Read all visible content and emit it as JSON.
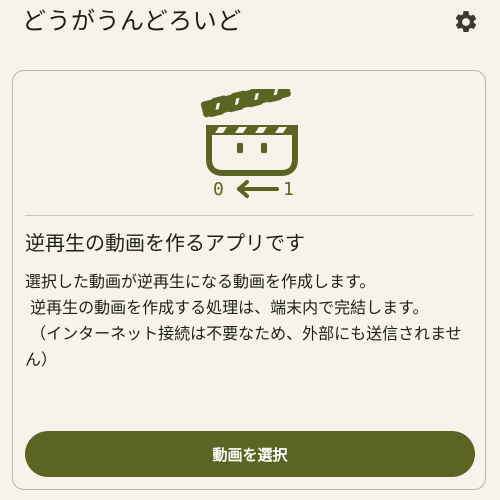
{
  "app": {
    "title": "どうがうんどろいど"
  },
  "header": {
    "settings_icon": "gear-icon"
  },
  "card": {
    "illustration_icon": "clapperboard-reverse-icon",
    "illustration_label_left": "0",
    "illustration_label_right": "1",
    "title": "逆再生の動画を作るアプリです",
    "description": "選択した動画が逆再生になる動画を作成します。\n 逆再生の動画を作成する処理は、端末内で完結します。\n （インターネット接続は不要なため、外部にも送信されません）",
    "select_button_label": "動画を選択"
  },
  "colors": {
    "accent": "#5c6423",
    "background": "#f5f3e9",
    "border": "#b9b6a8"
  }
}
